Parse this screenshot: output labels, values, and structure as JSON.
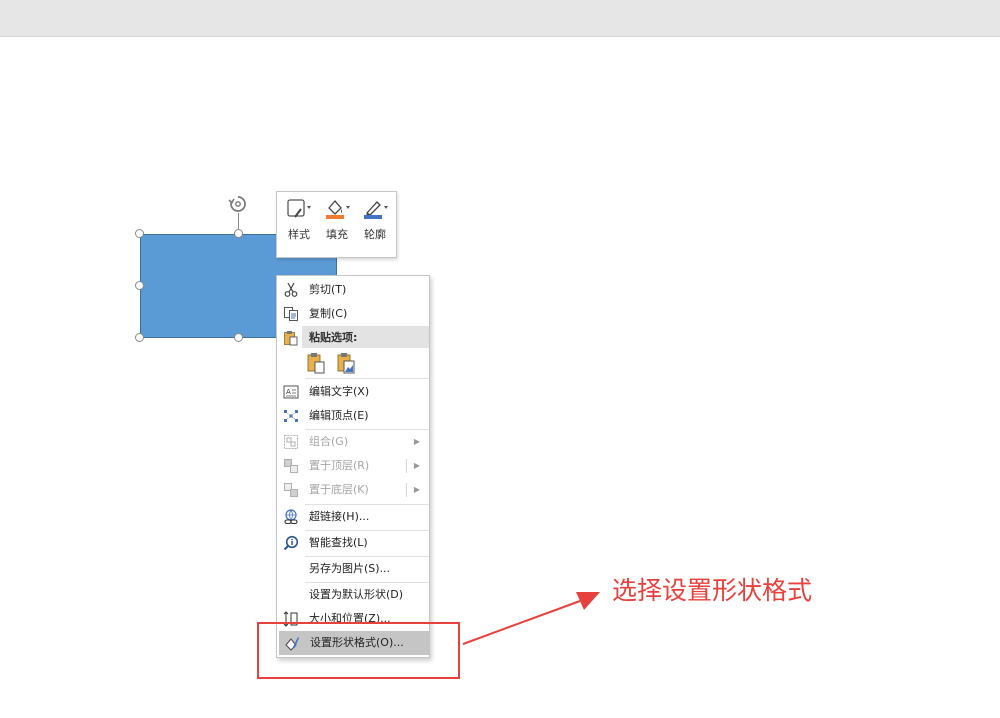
{
  "mini_toolbar": {
    "style_label": "样式",
    "fill_label": "填充",
    "outline_label": "轮廓"
  },
  "context_menu": {
    "cut": "剪切(T)",
    "copy": "复制(C)",
    "paste_options": "粘贴选项:",
    "edit_text": "编辑文字(X)",
    "edit_points": "编辑顶点(E)",
    "group": "组合(G)",
    "bring_to_front": "置于顶层(R)",
    "send_to_back": "置于底层(K)",
    "hyperlink": "超链接(H)...",
    "smart_lookup": "智能查找(L)",
    "save_as_picture": "另存为图片(S)...",
    "set_default_shape": "设置为默认形状(D)",
    "size_position": "大小和位置(Z)...",
    "format_shape": "设置形状格式(O)..."
  },
  "annotation": {
    "text": "选择设置形状格式"
  },
  "colors": {
    "shape_fill": "#5b9bd5",
    "fill_accent": "#ed7d31",
    "outline_accent": "#4472c4",
    "annotation_red": "#e8413d"
  }
}
